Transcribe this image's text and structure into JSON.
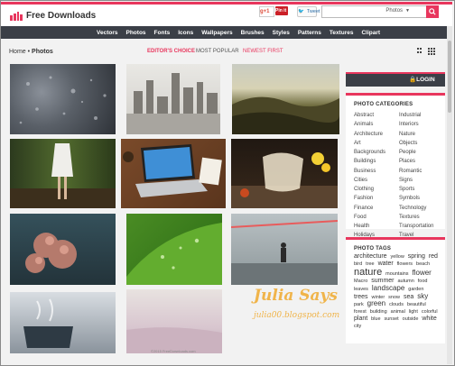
{
  "header": {
    "brand": "Free Downloads",
    "social": {
      "gplus": "g+1",
      "pin": "Pin it",
      "tweet": "Tweet"
    },
    "search": {
      "placeholder": "",
      "category": "Photos"
    }
  },
  "nav": {
    "items": [
      "Vectors",
      "Photos",
      "Fonts",
      "Icons",
      "Wallpapers",
      "Brushes",
      "Styles",
      "Patterns",
      "Textures",
      "Clipart"
    ]
  },
  "breadcrumb": {
    "home": "Home",
    "separator": "•",
    "current": "Photos"
  },
  "filters": {
    "editors_choice": "EDITOR'S CHOICE",
    "most_popular": "MOST POPULAR",
    "newest_first": "NEWEST FIRST"
  },
  "sidebar": {
    "login": "LOGIN",
    "categories_title": "PHOTO CATEGORIES",
    "categories_left": [
      "Abstract",
      "Animals",
      "Architecture",
      "Art",
      "Backgrounds",
      "Buildings",
      "Business",
      "Cities",
      "Clothing",
      "Fashion",
      "Finance",
      "Food",
      "Health",
      "Holidays"
    ],
    "categories_right": [
      "Industrial",
      "Interiors",
      "Nature",
      "Objects",
      "People",
      "Places",
      "Romantic",
      "Signs",
      "Sports",
      "Symbols",
      "Technology",
      "Textures",
      "Transportation",
      "Travel"
    ],
    "tags_title": "PHOTO TAGS",
    "tags": [
      {
        "text": "architecture",
        "size": 7
      },
      {
        "text": "yellow",
        "size": 5.5
      },
      {
        "text": "spring",
        "size": 7
      },
      {
        "text": "red",
        "size": 7
      },
      {
        "text": "bird",
        "size": 5.5
      },
      {
        "text": "tree",
        "size": 5.5
      },
      {
        "text": "water",
        "size": 7
      },
      {
        "text": "flowers",
        "size": 5.5
      },
      {
        "text": "beach",
        "size": 5.5
      },
      {
        "text": "nature",
        "size": 11
      },
      {
        "text": "mountains",
        "size": 5.5
      },
      {
        "text": "flower",
        "size": 8
      },
      {
        "text": "Macro",
        "size": 5.5
      },
      {
        "text": "summer",
        "size": 7
      },
      {
        "text": "autumn",
        "size": 5.5
      },
      {
        "text": "food",
        "size": 5.5
      },
      {
        "text": "leaves",
        "size": 5.5
      },
      {
        "text": "landscape",
        "size": 8
      },
      {
        "text": "garden",
        "size": 5.5
      },
      {
        "text": "trees",
        "size": 7
      },
      {
        "text": "winter",
        "size": 5.5
      },
      {
        "text": "snow",
        "size": 5.5
      },
      {
        "text": "sea",
        "size": 7
      },
      {
        "text": "sky",
        "size": 8
      },
      {
        "text": "park",
        "size": 5.5
      },
      {
        "text": "green",
        "size": 8
      },
      {
        "text": "clouds",
        "size": 5.5
      },
      {
        "text": "beautiful",
        "size": 5.5
      },
      {
        "text": "forest",
        "size": 5.5
      },
      {
        "text": "building",
        "size": 5.5
      },
      {
        "text": "animal",
        "size": 5.5
      },
      {
        "text": "light",
        "size": 5.5
      },
      {
        "text": "colorful",
        "size": 5.5
      },
      {
        "text": "plant",
        "size": 7
      },
      {
        "text": "blue",
        "size": 5.5
      },
      {
        "text": "sunset",
        "size": 5.5
      },
      {
        "text": "outside",
        "size": 5.5
      },
      {
        "text": "white",
        "size": 7
      },
      {
        "text": "city",
        "size": 5.5
      }
    ]
  },
  "watermark": {
    "title": "Julia Says",
    "url": "julia00.blogspot.com"
  },
  "credit": "©2015 FreeDownloads.com",
  "colors": {
    "accent": "#e8365d",
    "nav": "#3b3f47",
    "tagline": "#f0b44a"
  }
}
